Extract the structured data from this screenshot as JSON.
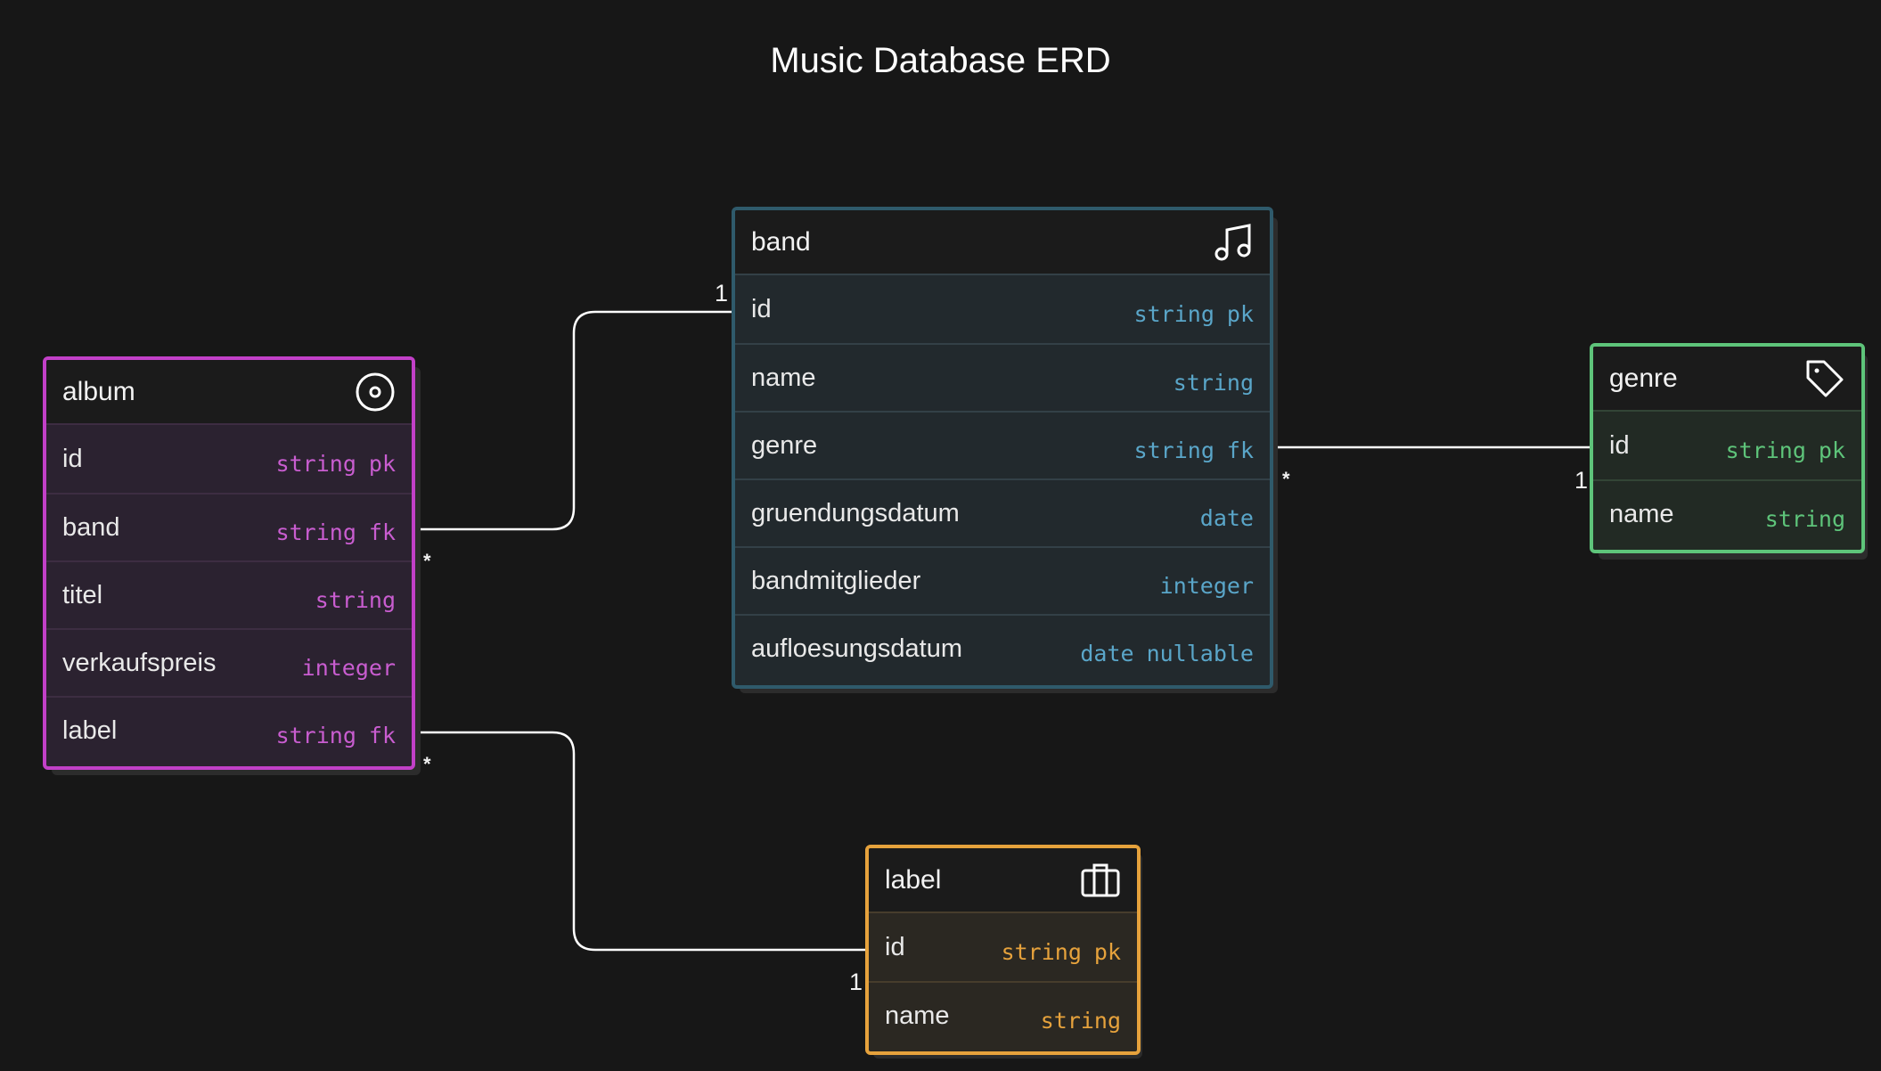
{
  "title": "Music Database ERD",
  "entities": {
    "album": {
      "name": "album",
      "icon": "disc-icon",
      "color": "#c240c8",
      "bg": "#2b2230",
      "fields": [
        {
          "name": "id",
          "type": "string",
          "key": "pk"
        },
        {
          "name": "band",
          "type": "string",
          "key": "fk"
        },
        {
          "name": "titel",
          "type": "string",
          "key": ""
        },
        {
          "name": "verkaufspreis",
          "type": "integer",
          "key": ""
        },
        {
          "name": "label",
          "type": "string",
          "key": "fk"
        }
      ]
    },
    "band": {
      "name": "band",
      "icon": "music-note-icon",
      "color": "#2f5a6b",
      "bg": "#22292d",
      "fields": [
        {
          "name": "id",
          "type": "string",
          "key": "pk"
        },
        {
          "name": "name",
          "type": "string",
          "key": ""
        },
        {
          "name": "genre",
          "type": "string",
          "key": "fk"
        },
        {
          "name": "gruendungsdatum",
          "type": "date",
          "key": ""
        },
        {
          "name": "bandmitglieder",
          "type": "integer",
          "key": ""
        },
        {
          "name": "aufloesungsdatum",
          "type": "date",
          "key": "nullable"
        }
      ]
    },
    "genre": {
      "name": "genre",
      "icon": "tag-icon",
      "color": "#5ec47a",
      "bg": "#222a24",
      "fields": [
        {
          "name": "id",
          "type": "string",
          "key": "pk"
        },
        {
          "name": "name",
          "type": "string",
          "key": ""
        }
      ]
    },
    "label": {
      "name": "label",
      "icon": "briefcase-icon",
      "color": "#e6a23c",
      "bg": "#2b2822",
      "fields": [
        {
          "name": "id",
          "type": "string",
          "key": "pk"
        },
        {
          "name": "name",
          "type": "string",
          "key": ""
        }
      ]
    }
  },
  "relationships": [
    {
      "from": "album.band",
      "to": "band.id",
      "from_card": "*",
      "to_card": "1"
    },
    {
      "from": "album.label",
      "to": "label.id",
      "from_card": "*",
      "to_card": "1"
    },
    {
      "from": "band.genre",
      "to": "genre.id",
      "from_card": "*",
      "to_card": "1"
    }
  ]
}
